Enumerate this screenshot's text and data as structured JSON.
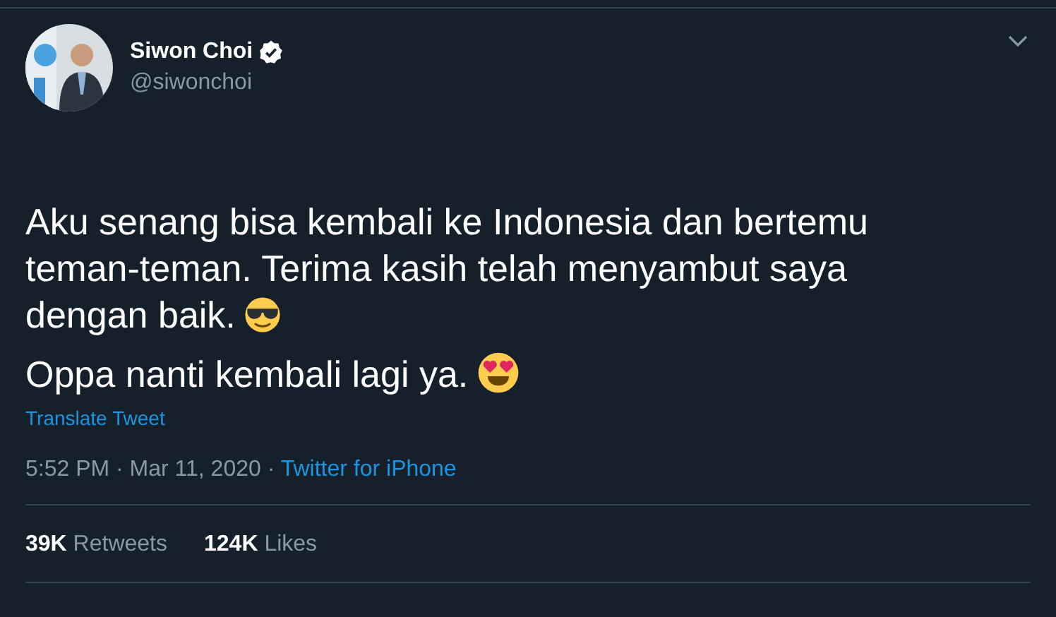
{
  "author": {
    "name": "Siwon Choi",
    "verified": true,
    "handle": "@siwonchoi"
  },
  "paragraphs": [
    {
      "text": "Aku senang bisa kembali ke Indonesia dan bertemu teman-teman. Terima kasih telah menyambut saya dengan baik.",
      "emoji": {
        "kind": "sunglasses"
      }
    },
    {
      "text": "Oppa nanti kembali lagi ya.",
      "emoji": {
        "kind": "heart_eyes"
      }
    }
  ],
  "translate": "Translate Tweet",
  "timestamp": "5:52 PM · Mar 11, 2020 · ",
  "source": "Twitter for iPhone",
  "stats": [
    {
      "text": "**39K** Retweets"
    },
    {
      "text": "**124K** Likes"
    }
  ]
}
